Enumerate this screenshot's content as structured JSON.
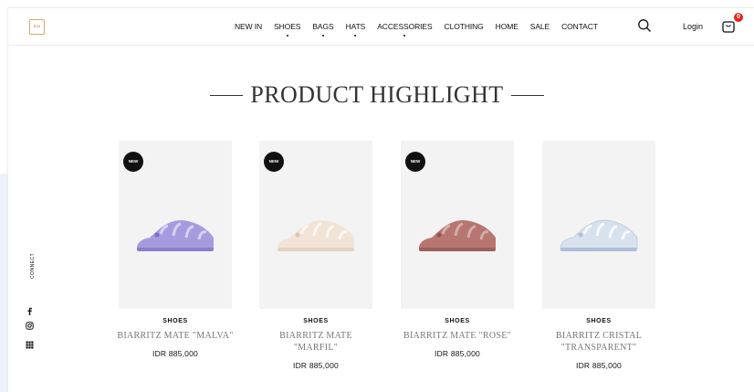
{
  "brand": {
    "logo_text": "niu",
    "accent_color": "#d9a36b"
  },
  "nav": {
    "items": [
      {
        "label": "NEW IN",
        "dropdown": false
      },
      {
        "label": "SHOES",
        "dropdown": true
      },
      {
        "label": "BAGS",
        "dropdown": true
      },
      {
        "label": "HATS",
        "dropdown": true
      },
      {
        "label": "ACCESSORIES",
        "dropdown": true
      },
      {
        "label": "CLOTHING",
        "dropdown": false
      },
      {
        "label": "HOME",
        "dropdown": false
      },
      {
        "label": "SALE",
        "dropdown": false
      },
      {
        "label": "CONTACT",
        "dropdown": false
      }
    ],
    "search_icon": "search-icon",
    "login_label": "Login",
    "cart_icon": "shopping-bag-icon",
    "cart_count": "0"
  },
  "section": {
    "title": "PRODUCT HIGHLIGHT"
  },
  "products": [
    {
      "badge": "NEW",
      "category": "SHOES",
      "name": "BIARRITZ MATE \"MALVA\"",
      "price": "IDR 885,000",
      "color": "#a79be0"
    },
    {
      "badge": "NEW",
      "category": "SHOES",
      "name": "BIARRITZ MATE \"MARFIL\"",
      "price": "IDR 885,000",
      "color": "#f1e4d6"
    },
    {
      "badge": "NEW",
      "category": "SHOES",
      "name": "BIARRITZ MATE \"ROSE\"",
      "price": "IDR 885,000",
      "color": "#b77670"
    },
    {
      "badge": "",
      "category": "SHOES",
      "name": "BIARRITZ CRISTAL \"TRANSPARENT\"",
      "price": "IDR 885,000",
      "color": "#d8e2ef"
    }
  ],
  "sidebar": {
    "connect_label": "CONNECT",
    "icons": [
      "facebook-icon",
      "instagram-icon",
      "grid-icon"
    ]
  }
}
